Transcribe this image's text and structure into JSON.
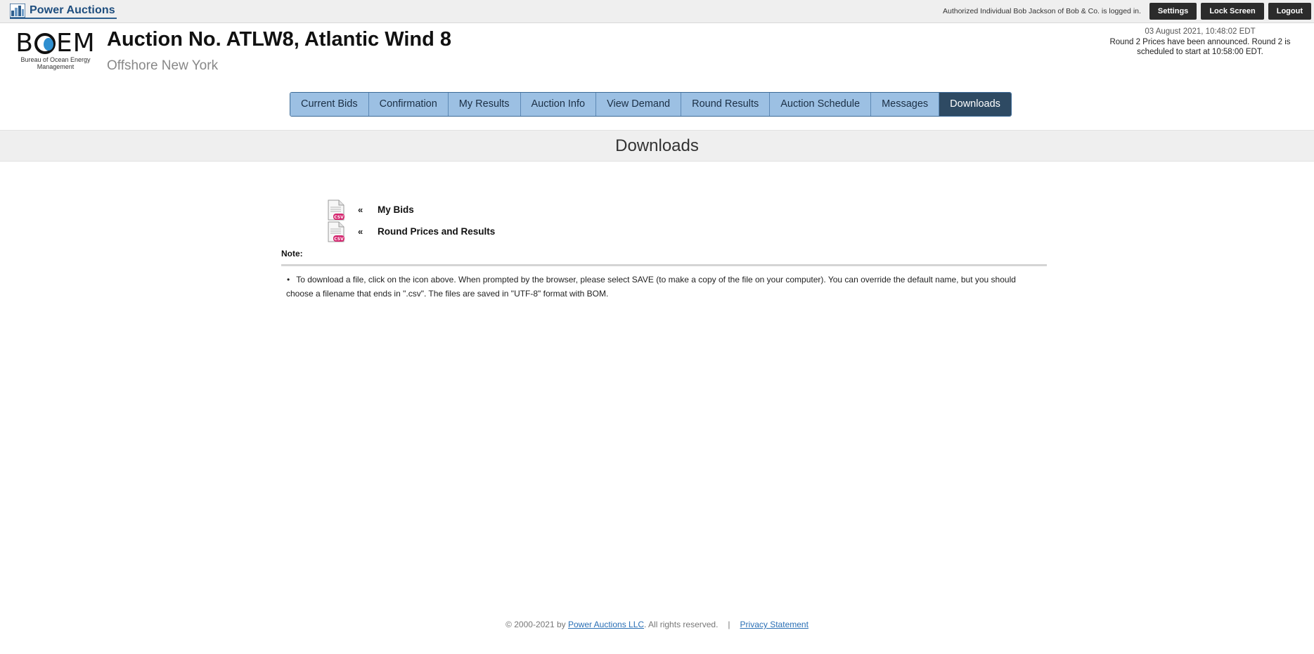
{
  "topbar": {
    "brand": "Power Auctions",
    "login_text": "Authorized Individual Bob Jackson of Bob & Co. is logged in.",
    "settings_label": "Settings",
    "lock_label": "Lock Screen",
    "logout_label": "Logout"
  },
  "header": {
    "logo_word_left": "B",
    "logo_word_right": "EM",
    "logo_sub_line1": "Bureau of Ocean Energy",
    "logo_sub_line2": "Management",
    "title": "Auction No. ATLW8, Atlantic Wind 8",
    "subtitle": "Offshore New York",
    "date": "03 August 2021, 10:48:02 EDT",
    "announcement": "Round 2 Prices have been announced. Round 2 is scheduled to start at 10:58:00 EDT."
  },
  "tabs": [
    {
      "label": "Current Bids"
    },
    {
      "label": "Confirmation"
    },
    {
      "label": "My Results"
    },
    {
      "label": "Auction Info"
    },
    {
      "label": "View Demand"
    },
    {
      "label": "Round Results"
    },
    {
      "label": "Auction Schedule"
    },
    {
      "label": "Messages"
    },
    {
      "label": "Downloads"
    }
  ],
  "active_tab": "Downloads",
  "section_title": "Downloads",
  "downloads": [
    {
      "arrow": "«",
      "label": "My Bids",
      "icon": "csv-file-icon"
    },
    {
      "arrow": "«",
      "label": "Round Prices and Results",
      "icon": "csv-file-icon"
    }
  ],
  "note": {
    "label": "Note:",
    "bullet": "•",
    "text": "To download a file, click on the icon above. When prompted by the browser, please select SAVE (to make a copy of the file on your computer). You can override the default name, but you should choose a filename that ends in \".csv\". The files are saved in \"UTF-8\" format with BOM."
  },
  "footer": {
    "copyright": "© 2000-2021 by ",
    "company_link": "Power Auctions LLC",
    "rights": ". All rights reserved.",
    "separator": "|",
    "privacy_link": "Privacy Statement"
  },
  "colors": {
    "tab_bg": "#9cc0e3",
    "tab_active_bg": "#2e4a63",
    "brand_blue": "#1d4d7e",
    "boem_blue": "#2f8fd0",
    "csv_badge": "#d4256e",
    "dark_button": "#2b2b2b"
  }
}
